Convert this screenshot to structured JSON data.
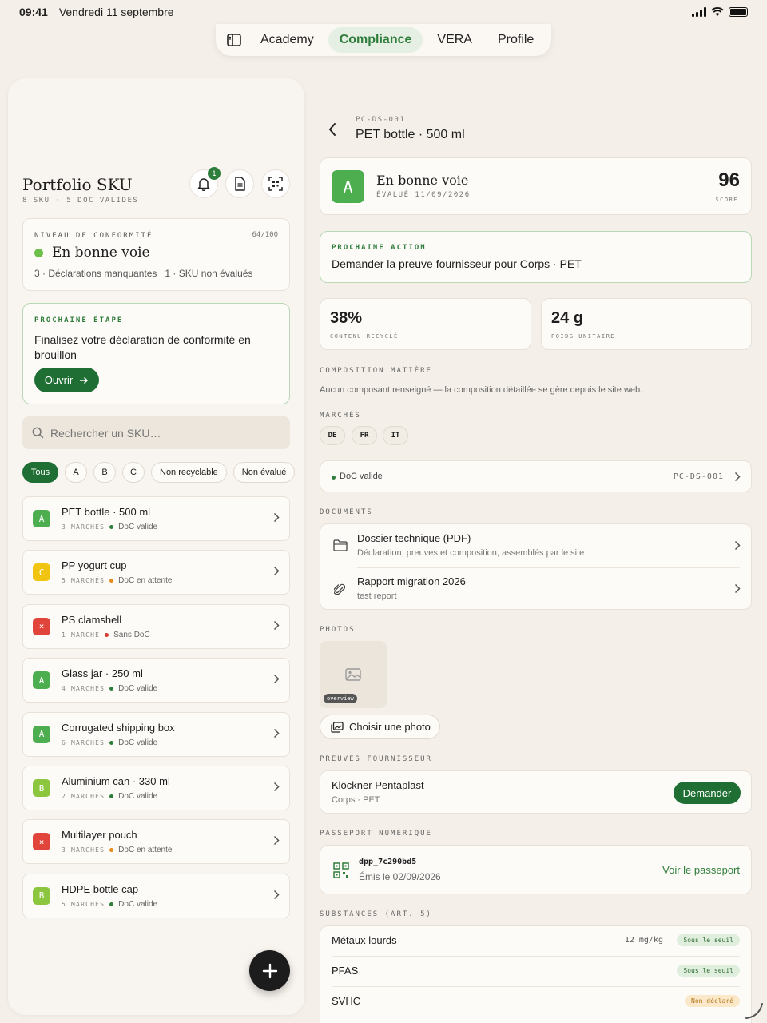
{
  "status": {
    "time": "09:41",
    "date": "Vendredi 11 septembre"
  },
  "nav": {
    "tabs": [
      {
        "label": "Academy"
      },
      {
        "label": "Compliance"
      },
      {
        "label": "VERA"
      },
      {
        "label": "Profile"
      }
    ],
    "active": "Compliance"
  },
  "portfolio": {
    "title": "Portfolio SKU",
    "subtitle": "8 SKU · 5 DOC VALIDES",
    "notif_count": "1",
    "compliance": {
      "kicker": "NIVEAU DE CONFORMITÉ",
      "score": "64/100",
      "state": "En bonne voie",
      "stats": "3 · Déclarations manquantes   1 · SKU non évalués"
    },
    "next_step": {
      "kicker": "PROCHAINE ÉTAPE",
      "text": "Finalisez votre déclaration de conformité en brouillon",
      "button": "Ouvrir"
    },
    "search_placeholder": "Rechercher un SKU…",
    "filters": [
      "Tous",
      "A",
      "B",
      "C",
      "Non recyclable",
      "Non évalué"
    ],
    "skus": [
      {
        "grade": "A",
        "color": "#4cae4f",
        "name": "PET bottle · 500 ml",
        "markets": "3 MARCHÉS",
        "status": "DoC valide",
        "status_color": "#2f7d3a"
      },
      {
        "grade": "C",
        "color": "#f1c40f",
        "name": "PP yogurt cup",
        "markets": "5 MARCHÉS",
        "status": "DoC en attente",
        "status_color": "#e8891b"
      },
      {
        "grade": "×",
        "color": "#e0443a",
        "name": "PS clamshell",
        "markets": "1 MARCHÉ",
        "status": "Sans DoC",
        "status_color": "#d63a2f"
      },
      {
        "grade": "A",
        "color": "#4cae4f",
        "name": "Glass jar · 250 ml",
        "markets": "4 MARCHÉS",
        "status": "DoC valide",
        "status_color": "#2f7d3a"
      },
      {
        "grade": "A",
        "color": "#4cae4f",
        "name": "Corrugated shipping box",
        "markets": "6 MARCHÉS",
        "status": "DoC valide",
        "status_color": "#2f7d3a"
      },
      {
        "grade": "B",
        "color": "#8cc63f",
        "name": "Aluminium can · 330 ml",
        "markets": "2 MARCHÉS",
        "status": "DoC valide",
        "status_color": "#2f7d3a"
      },
      {
        "grade": "×",
        "color": "#e0443a",
        "name": "Multilayer pouch",
        "markets": "3 MARCHÉS",
        "status": "DoC en attente",
        "status_color": "#e8891b"
      },
      {
        "grade": "B",
        "color": "#8cc63f",
        "name": "HDPE bottle cap",
        "markets": "5 MARCHÉS",
        "status": "DoC valide",
        "status_color": "#2f7d3a"
      }
    ]
  },
  "detail": {
    "code": "PC-DS-001",
    "title": "PET bottle · 500 ml",
    "grade": "A",
    "state": "En bonne voie",
    "evaluated": "ÉVALUÉ 11/09/2026",
    "score": "96",
    "score_label": "SCORE",
    "next_action": {
      "kicker": "PROCHAINE ACTION",
      "text": "Demander la preuve fournisseur pour Corps · PET"
    },
    "metrics": [
      {
        "value": "38%",
        "label": "CONTENU RECYCLÉ"
      },
      {
        "value": "24 g",
        "label": "POIDS UNITAIRE"
      }
    ],
    "composition": {
      "label": "COMPOSITION MATIÈRE",
      "text": "Aucun composant renseigné — la composition détaillée se gère depuis le site web."
    },
    "markets": {
      "label": "MARCHÉS",
      "items": [
        "DE",
        "FR",
        "IT"
      ]
    },
    "doc": {
      "status": "DoC valide",
      "code": "PC-DS-001"
    },
    "documents": {
      "label": "DOCUMENTS",
      "items": [
        {
          "title": "Dossier technique (PDF)",
          "sub": "Déclaration, preuves et composition, assemblés par le site"
        },
        {
          "title": "Rapport migration 2026",
          "sub": "test report"
        }
      ]
    },
    "photos": {
      "label": "PHOTOS",
      "tag": "overview",
      "button": "Choisir une photo"
    },
    "supplier": {
      "label": "PREUVES FOURNISSEUR",
      "name": "Klöckner Pentaplast",
      "sub": "Corps · PET",
      "button": "Demander"
    },
    "passport": {
      "label": "PASSEPORT NUMÉRIQUE",
      "id": "dpp_7c290bd5",
      "issued": "Émis le 02/09/2026",
      "link": "Voir le passeport"
    },
    "substances": {
      "label": "SUBSTANCES (ART. 5)",
      "items": [
        {
          "name": "Métaux lourds",
          "value": "12 mg/kg",
          "pill": "Sous le seuil"
        },
        {
          "name": "PFAS",
          "value": "",
          "pill": "Sous le seuil"
        },
        {
          "name": "SVHC",
          "value": "",
          "pill": "Non déclaré"
        }
      ]
    }
  }
}
